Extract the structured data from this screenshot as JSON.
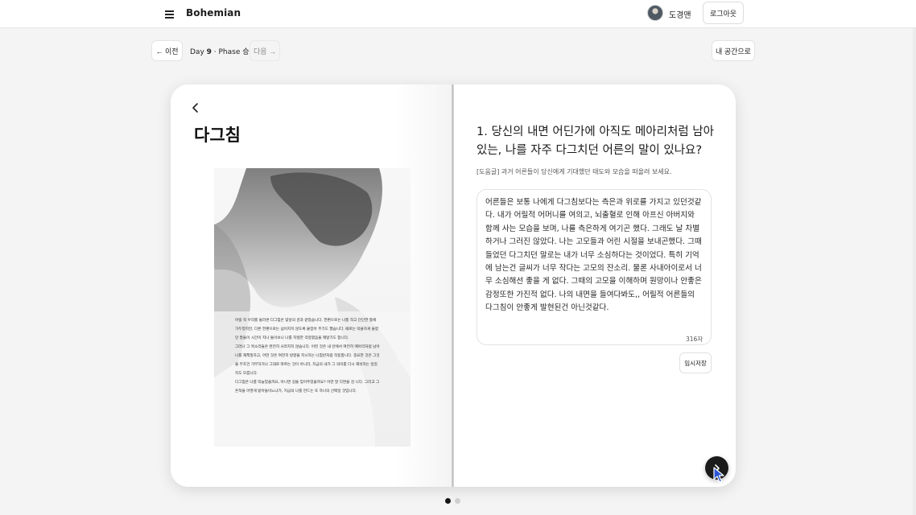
{
  "header": {
    "brand": "Bohemian",
    "username": "도경맨",
    "logout_label": "로그아웃"
  },
  "nav": {
    "prev_label": "← 이전",
    "day_prefix": "Day ",
    "day_number": "9",
    "phase_label": " · Phase 승",
    "next_label": "다음 →",
    "my_space_label": "내 공간으로"
  },
  "left_page": {
    "title": "다그침",
    "photo_paragraphs": [
      "어릴 적 우리를 둘러싼 다그침은 맞날의 검과 같았습니다. 한편으로는 나를 작고 단단한 틀에 가두었지만, 다른 한편으로는 넘어지지 않도록 붙잡아 주기도 했습니다. 때로는 막을하게 들렸던 말들이 시간이 지나 돌이보니 나를 지탱한 걱정였음을 깨달기도 합니다.",
      "그러나 그 목소리들은 완전히 사라지지 않습니다. 어떤 것은 내 안에서 여전히 메아리처럼 남아 나를 재책질하고, 어떤 것은 여전히 방향을 지시하는 나침반처럼 작동합니다. 중요한 것은 그것을 무조건 거부하거나 그대로 따르는 것이 아니라, 지금의 내가 그 의미를 다시 해석하는 일일지도 모릅니다.",
      "다그침은 나를 익늘었을까요, 아니면 길을 잊어주었을까요? 어떤 말 다면을 검 니다. 그리고 그 흔적을 어떻게 받아들이느냐가, 지금의 나를 만드는 또 하나의 선택일 것입니다."
    ]
  },
  "right_page": {
    "question": "1. 당신의 내면 어딘가에 아직도 메아리처럼 남아 있는, 나를 자주 다그치던 어른의 말이 있나요?",
    "hint": "[도움글] 과거 어른들이 당신에게 기대했던 태도와 모습을 떠올려 보세요.",
    "answer": "어른들은 보통 나에게 다그침보다는 측은과 위로를 가지고 있던것같다. 내가 어릴적 어머니를 여의고, 뇌출혈로 인해 아프신 아버지와 함께 사는 모습을 보며, 나를 측은하게 여기곤 했다. 그래도 날 차별하거나 그러진 않았다. 나는 고모들과 어린 시절을 보내곤했다. 그때 들었던 다그치던 말로는 내가 너무 소심하다는 것이었다. 특히 기억에 남는건 글씨가 너무 작다는 고모의 잔소리. 물론 사내아이로서 너무 소심해선 좋을 게 없다. 그때의 고모을 이해하며 원망이나 안좋은 감정또한 가진적 없다. 나의 내면을 들여다봐도,, 어릴적 어른들의 다그침이 안좋게 발현된건 아닌것같다.",
    "char_count": "316자",
    "save_label": "임시저장"
  },
  "icons": {
    "menu": "hamburger-menu-icon",
    "back": "chevron-left-icon",
    "next_page": "chevron-right-icon"
  },
  "pagination": {
    "total": 2,
    "active": 1
  },
  "colors": {
    "background": "#f4f4f4",
    "surface": "#ffffff",
    "fab": "#1b1b1b",
    "active_dot": "#151515",
    "inactive_dot": "#cfcfcf"
  }
}
